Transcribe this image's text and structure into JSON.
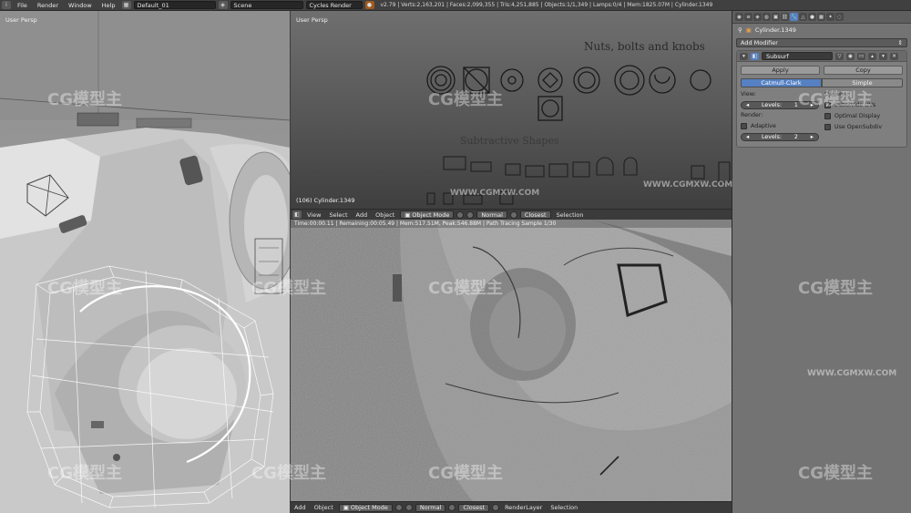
{
  "topbar": {
    "menus": [
      "File",
      "Render",
      "Window",
      "Help"
    ],
    "screen_layout": "Default_01",
    "scene": "Scene",
    "engine": "Cycles Render",
    "stats": "v2.79 | Verts:2,163,201 | Faces:2,099,355 | Tris:4,251,885 | Objects:1/1,349 | Lamps:0/4 | Mem:1825.07M | Cylinder.1349"
  },
  "left_view": {
    "label": "User Persp"
  },
  "top_right_view": {
    "label": "User Persp",
    "object_label": "(106) Cylinder.1349",
    "text_nuts": "Nuts, bolts and knobs",
    "text_subtractive": "Subtractive Shapes"
  },
  "mid_header": {
    "items": [
      "View",
      "Select",
      "Add",
      "Object"
    ],
    "mode": "Object Mode",
    "shading": "Normal",
    "pivot": "Closest",
    "more": "Selection"
  },
  "render_view": {
    "status": "Time:00:00.11 | Remaining:00:05.49 | Mem:517.51M, Peak:546.88M | Path Tracing Sample 1/30"
  },
  "bottom_header": {
    "items": [
      "Add",
      "Object"
    ],
    "mode": "Object Mode",
    "shading": "Normal",
    "pivot": "Closest",
    "layer": "RenderLayer",
    "more": "Selection"
  },
  "properties": {
    "context_object": "Cylinder.1349",
    "add_modifier": "Add Modifier",
    "modifier_name": "Subsurf",
    "apply": "Apply",
    "copy": "Copy",
    "subdiv_types": [
      "Catmull-Clark",
      "Simple"
    ],
    "view_label": "View:",
    "levels_label": "Levels:",
    "levels_value": "1",
    "render_label": "Render:",
    "adaptive": "Adaptive",
    "render_levels_value": "2",
    "options_label": "Options:",
    "subdivide_uvs": "Subdivide UVs",
    "optimal_display": "Optimal Display",
    "use_opensubdiv": "Use OpenSubdiv"
  },
  "watermark": {
    "brand": "CG模型主",
    "url": "WWW.CGMXW.COM"
  },
  "colors": {
    "accent": "#5680c2",
    "panel": "#737373",
    "header": "#3b3b3b"
  }
}
